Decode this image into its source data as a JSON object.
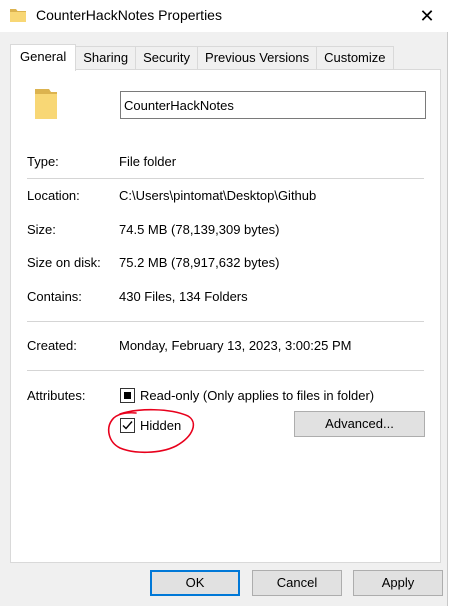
{
  "window": {
    "title": "CounterHackNotes Properties",
    "close_symbol": "✕"
  },
  "tabs": [
    {
      "label": "General",
      "active": true
    },
    {
      "label": "Sharing",
      "active": false
    },
    {
      "label": "Security",
      "active": false
    },
    {
      "label": "Previous Versions",
      "active": false
    },
    {
      "label": "Customize",
      "active": false
    }
  ],
  "general": {
    "folder_name": "CounterHackNotes",
    "type": {
      "label": "Type:",
      "value": "File folder"
    },
    "location": {
      "label": "Location:",
      "value": "C:\\Users\\pintomat\\Desktop\\Github"
    },
    "size": {
      "label": "Size:",
      "value": "74.5 MB (78,139,309 bytes)"
    },
    "size_on_disk": {
      "label": "Size on disk:",
      "value": "75.2 MB (78,917,632 bytes)"
    },
    "contains": {
      "label": "Contains:",
      "value": "430 Files, 134 Folders"
    },
    "created": {
      "label": "Created:",
      "value": "Monday, February 13, 2023, 3:00:25 PM"
    },
    "attributes": {
      "label": "Attributes:",
      "read_only": {
        "label": "Read-only (Only applies to files in folder)",
        "state": "indeterminate"
      },
      "hidden": {
        "label": "Hidden",
        "state": "checked"
      },
      "advanced_label": "Advanced..."
    }
  },
  "footer": {
    "ok_label": "OK",
    "cancel_label": "Cancel",
    "apply_label": "Apply"
  },
  "colors": {
    "folder": "#f8d775",
    "accent": "#0078d7",
    "annotation": "#e8001c"
  }
}
